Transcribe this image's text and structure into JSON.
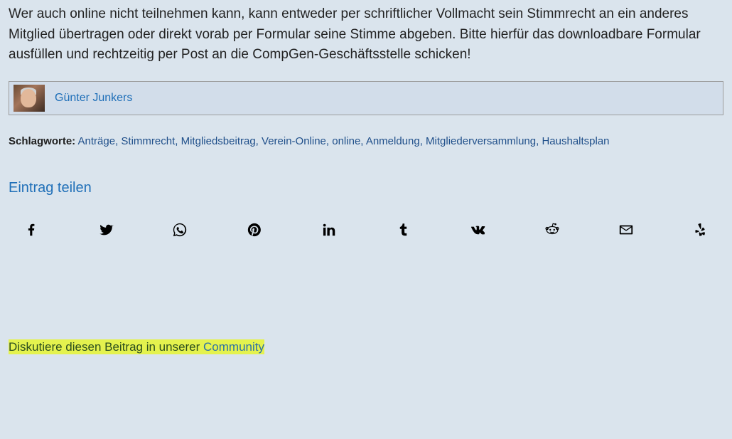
{
  "paragraph": "Wer auch online nicht teilnehmen kann, kann entweder per schriftlicher Vollmacht sein Stimmrecht an ein anderes Mitglied übertragen oder direkt vorab per Formular seine Stimme abgeben. Bitte hierfür das downloadbare Formular ausfüllen und rechtzeitig per Post an die CompGen-Geschäftsstelle schicken!",
  "author": {
    "name": "Günter Junkers"
  },
  "tags": {
    "label": "Schlagworte:",
    "items": [
      "Anträge",
      "Stimmrecht",
      "Mitgliedsbeitrag",
      "Verein-Online",
      "online",
      "Anmeldung",
      "Mitgliederversammlung",
      "Haushaltsplan"
    ]
  },
  "share": {
    "heading": "Eintrag teilen",
    "buttons": [
      {
        "name": "facebook"
      },
      {
        "name": "twitter"
      },
      {
        "name": "whatsapp"
      },
      {
        "name": "pinterest"
      },
      {
        "name": "linkedin"
      },
      {
        "name": "tumblr"
      },
      {
        "name": "vk"
      },
      {
        "name": "reddit"
      },
      {
        "name": "mail"
      },
      {
        "name": "yelp"
      }
    ]
  },
  "discuss": {
    "prefix": "Diskutiere diesen Beitrag in unserer ",
    "link": "Community"
  }
}
